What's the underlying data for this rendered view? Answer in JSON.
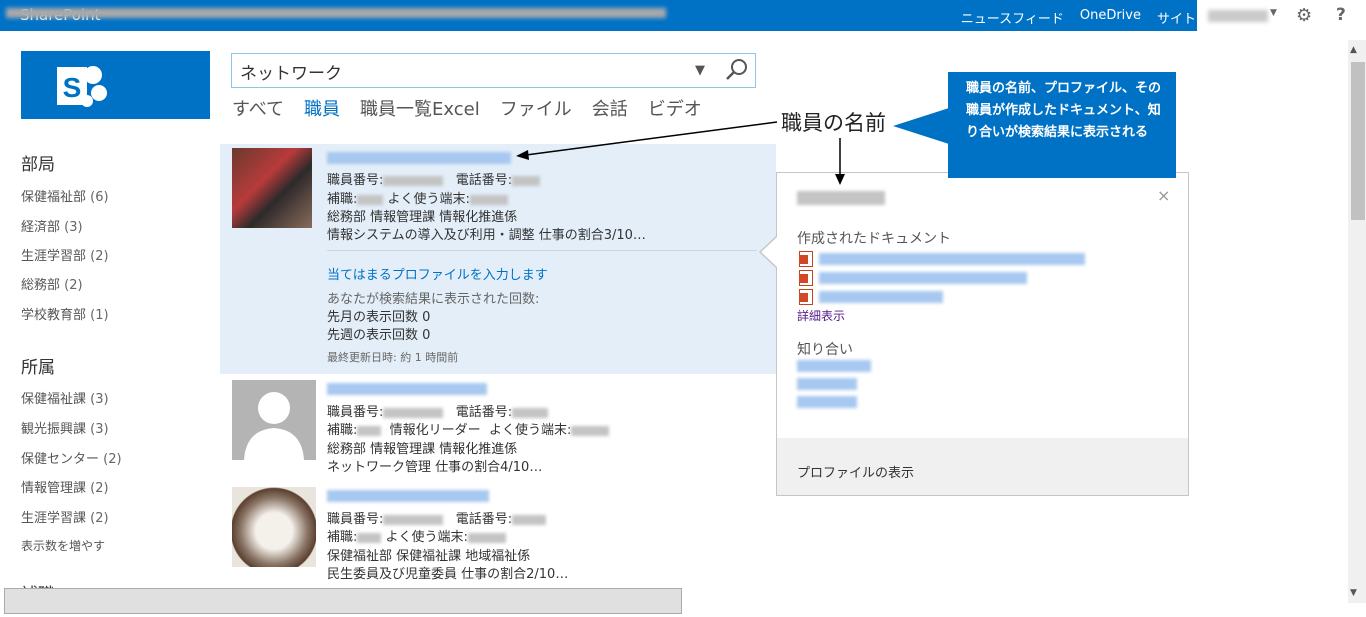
{
  "suite": {
    "brand": "SharePoint",
    "links": [
      "ニュースフィード",
      "OneDrive",
      "サイト"
    ],
    "help": "?"
  },
  "search": {
    "query": "ネットワーク",
    "verticals": [
      "すべて",
      "職員",
      "職員一覧Excel",
      "ファイル",
      "会話",
      "ビデオ"
    ],
    "active_vertical": "職員"
  },
  "refiners": {
    "dept_title": "部局",
    "dept_items": [
      {
        "label": "保健福祉部",
        "count": "(6)"
      },
      {
        "label": "経済部",
        "count": "(3)"
      },
      {
        "label": "生涯学習部",
        "count": "(2)"
      },
      {
        "label": "総務部",
        "count": "(2)"
      },
      {
        "label": "学校教育部",
        "count": "(1)"
      }
    ],
    "section_title": "所属",
    "section_items": [
      {
        "label": "保健福祉課",
        "count": "(3)"
      },
      {
        "label": "観光振興課",
        "count": "(3)"
      },
      {
        "label": "保健センター",
        "count": "(2)"
      },
      {
        "label": "情報管理課",
        "count": "(2)"
      },
      {
        "label": "生涯学習課",
        "count": "(2)"
      }
    ],
    "show_more": "表示数を増やす",
    "partial_title": "補職"
  },
  "results": [
    {
      "employee_no_label": "職員番号:",
      "phone_label": "電話番号:",
      "post_label": "補職:",
      "terminal_label": "よく使う端末:",
      "dept_line": "総務部  情報管理課  情報化推進係",
      "duty_line": "情報システムの導入及び利用・調整 仕事の割合3/10…",
      "profile_link": "当てはまるプロファイルを入力します",
      "views_label": "あなたが検索結果に表示された回数:",
      "last_month": "先月の表示回数 0",
      "last_week": "先週の表示回数 0",
      "updated": "最終更新日時: 約 1 時間前"
    },
    {
      "employee_no_label": "職員番号:",
      "phone_label": "電話番号:",
      "post_label": "補職:",
      "role": "情報化リーダー",
      "terminal_label": "よく使う端末:",
      "dept_line": "総務部  情報管理課  情報化推進係",
      "duty_line": "ネットワーク管理 仕事の割合4/10…"
    },
    {
      "employee_no_label": "職員番号:",
      "phone_label": "電話番号:",
      "post_label": "補職:",
      "terminal_label": "よく使う端末:",
      "dept_line": "保健福祉部  保健福祉課  地域福祉係",
      "duty_line": "民生委員及び児童委員 仕事の割合2/10…"
    }
  ],
  "hovercard": {
    "docs_title": "作成されたドキュメント",
    "show_more": "詳細表示",
    "acquaintances_title": "知り合い",
    "view_profile": "プロファイルの表示",
    "close": "×"
  },
  "annotations": {
    "label": "職員の名前",
    "callout": "職員の名前、プロファイル、その職員が作成したドキュメント、知り合いが検索結果に表示される"
  },
  "colors": {
    "suite_blue": "#0072c6",
    "result_highlight": "#e3eef9"
  }
}
